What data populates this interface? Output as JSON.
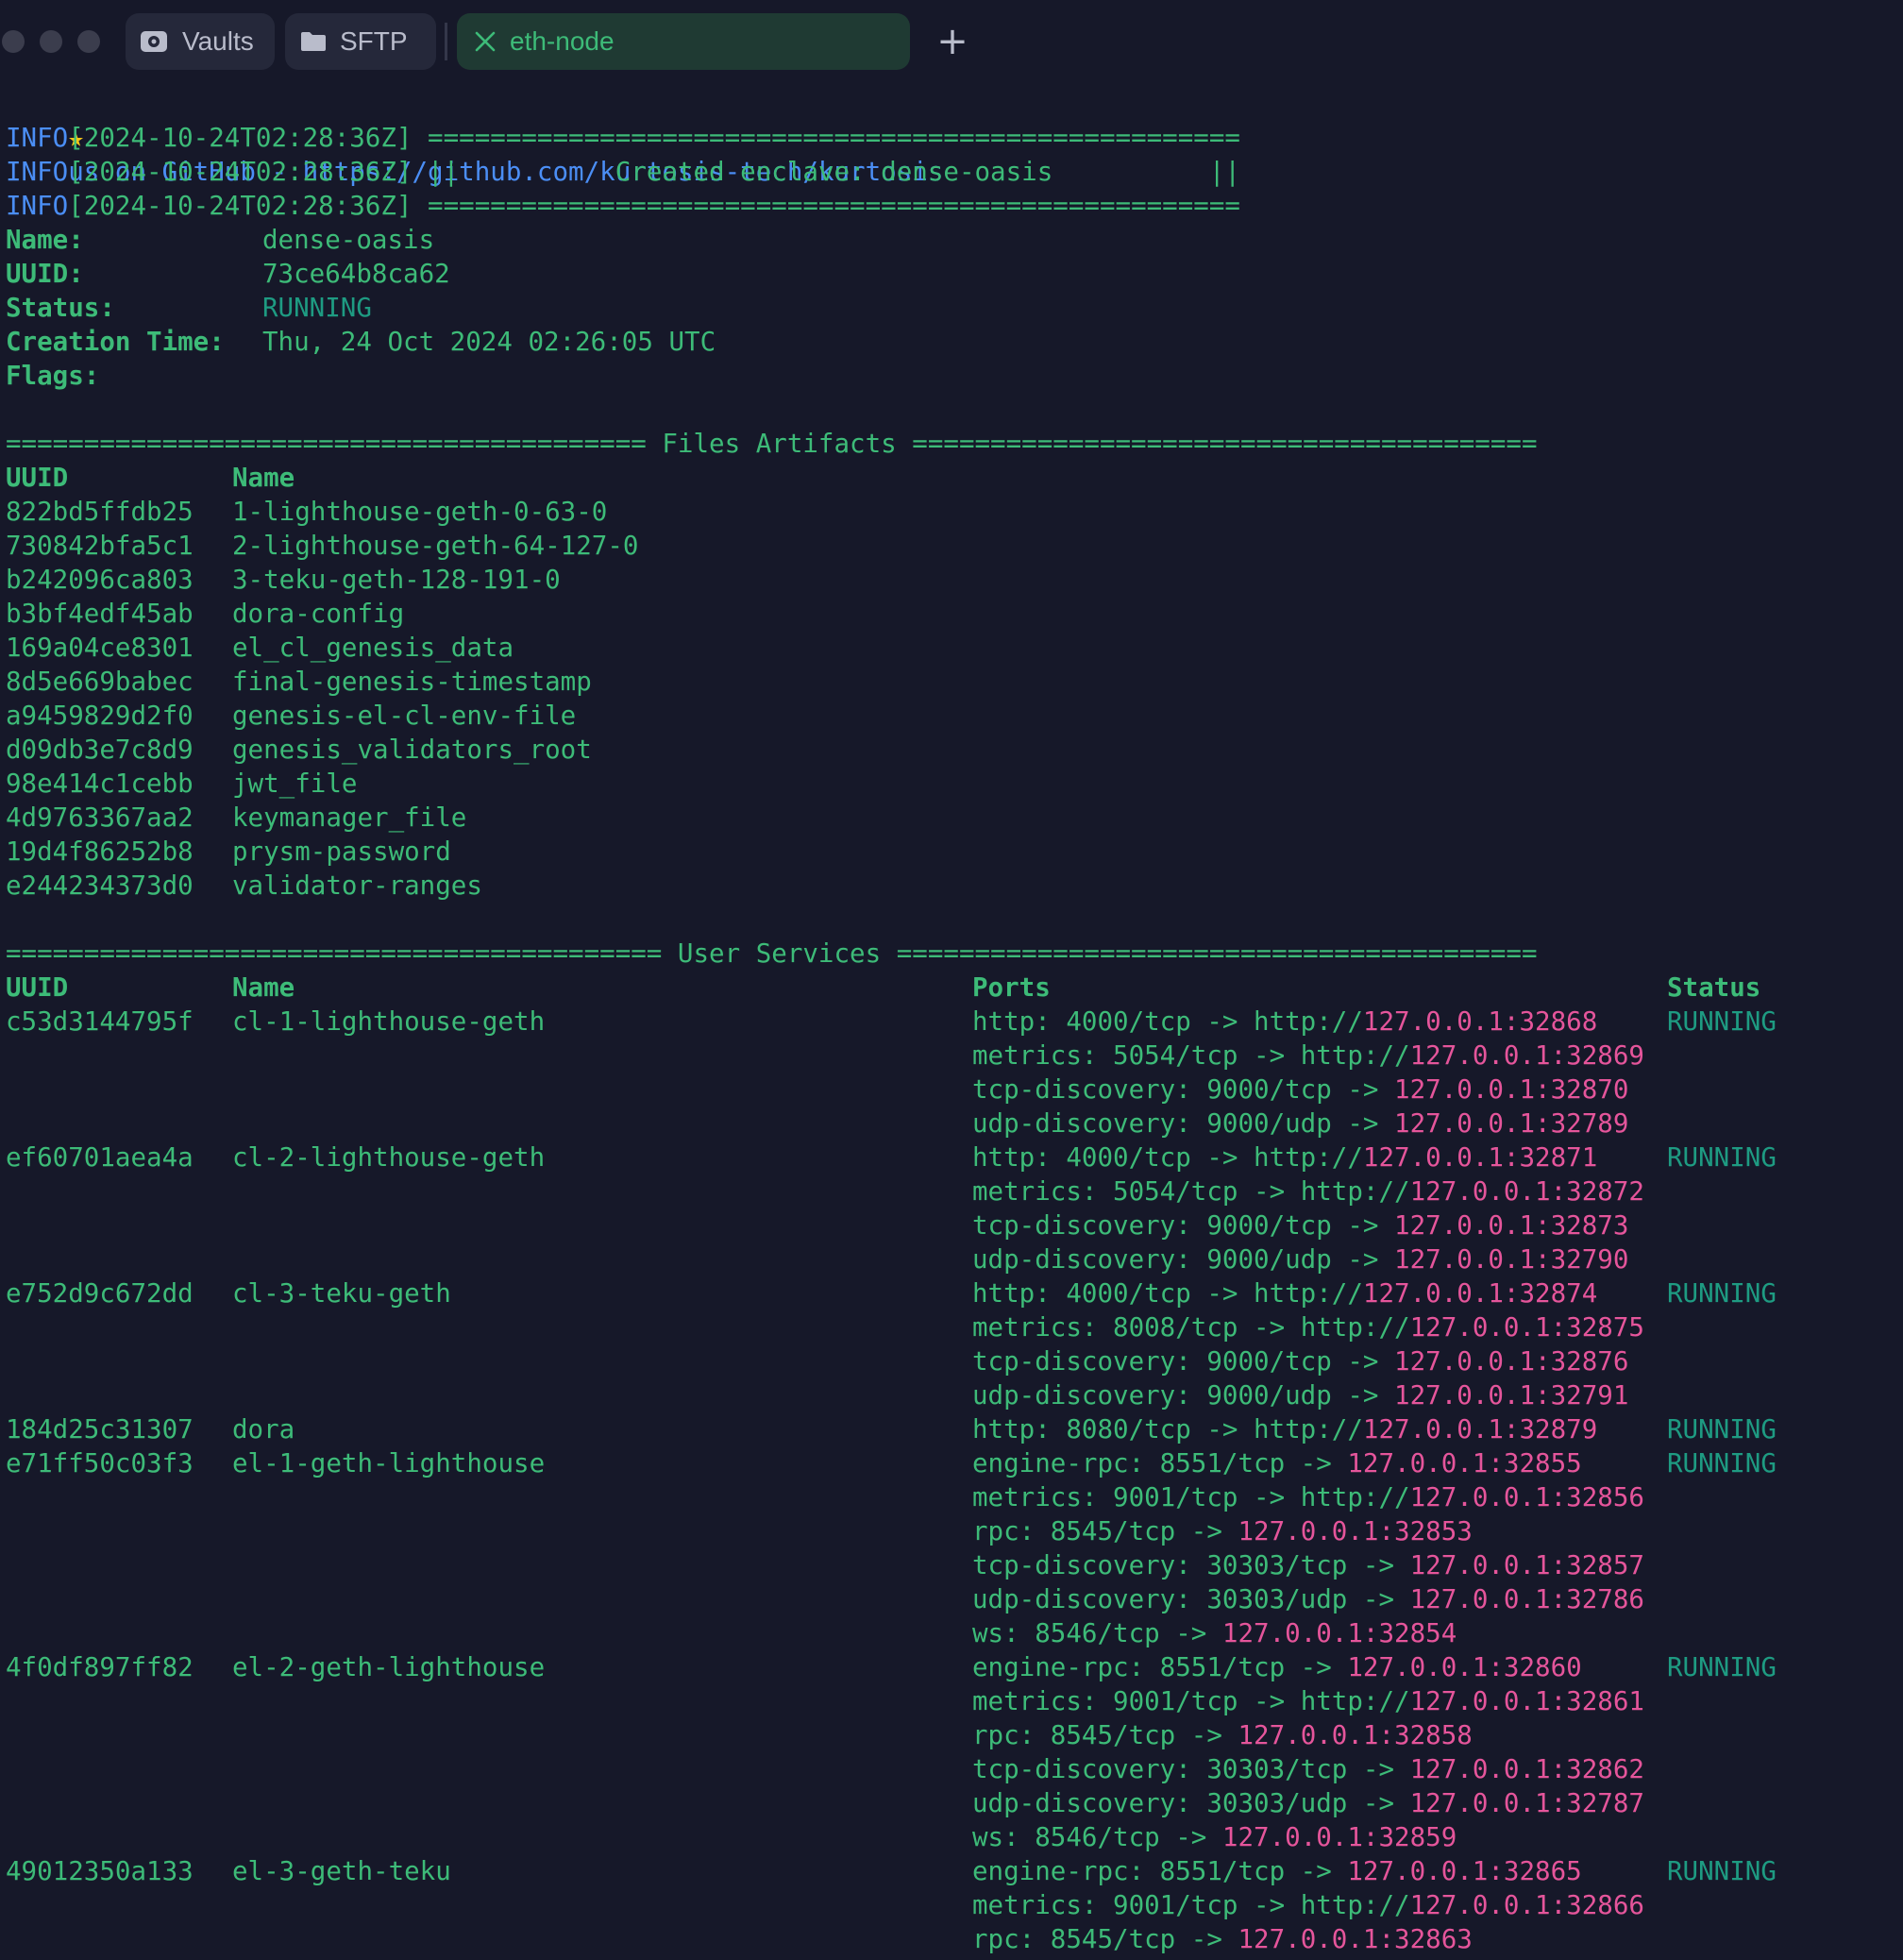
{
  "window": {
    "tabs": [
      {
        "label": "Vaults",
        "icon": "vault-icon"
      },
      {
        "label": "SFTP",
        "icon": "folder-icon"
      },
      {
        "label": "eth-node",
        "icon": "close-icon",
        "active": true
      }
    ],
    "new_tab": "+"
  },
  "terminal": {
    "github_line": "us on GitHub - https://github.com/kurtosis-tech/kurtosis",
    "info_prefix": "INFO",
    "info_lines": [
      "[2024-10-24T02:28:36Z] ====================================================",
      "[2024-10-24T02:28:36Z] ||          Created enclave: dense-oasis          ||",
      "[2024-10-24T02:28:36Z] ===================================================="
    ],
    "enclave": {
      "name_label": "Name:",
      "name": "dense-oasis",
      "uuid_label": "UUID:",
      "uuid": "73ce64b8ca62",
      "status_label": "Status:",
      "status": "RUNNING",
      "creation_label": "Creation Time:",
      "creation_time": "Thu, 24 Oct 2024 02:26:05 UTC",
      "flags_label": "Flags:"
    },
    "files_header": "========================================= Files Artifacts ========================================",
    "files_columns": {
      "uuid": "UUID",
      "name": "Name"
    },
    "files": [
      {
        "uuid": "822bd5ffdb25",
        "name": "1-lighthouse-geth-0-63-0"
      },
      {
        "uuid": "730842bfa5c1",
        "name": "2-lighthouse-geth-64-127-0"
      },
      {
        "uuid": "b242096ca803",
        "name": "3-teku-geth-128-191-0"
      },
      {
        "uuid": "b3bf4edf45ab",
        "name": "dora-config"
      },
      {
        "uuid": "169a04ce8301",
        "name": "el_cl_genesis_data"
      },
      {
        "uuid": "8d5e669babec",
        "name": "final-genesis-timestamp"
      },
      {
        "uuid": "a9459829d2f0",
        "name": "genesis-el-cl-env-file"
      },
      {
        "uuid": "d09db3e7c8d9",
        "name": "genesis_validators_root"
      },
      {
        "uuid": "98e414c1cebb",
        "name": "jwt_file"
      },
      {
        "uuid": "4d9763367aa2",
        "name": "keymanager_file"
      },
      {
        "uuid": "19d4f86252b8",
        "name": "prysm-password"
      },
      {
        "uuid": "e244234373d0",
        "name": "validator-ranges"
      }
    ],
    "services_header": "========================================== User Services =========================================",
    "services_columns": {
      "uuid": "UUID",
      "name": "Name",
      "ports": "Ports",
      "status": "Status"
    },
    "services": [
      {
        "uuid": "c53d3144795f",
        "name": "cl-1-lighthouse-geth",
        "status": "RUNNING",
        "ports": [
          {
            "label": "http: 4000/tcp -> ",
            "target": "http://127.0.0.1:32868"
          },
          {
            "label": "metrics: 5054/tcp -> ",
            "target": "http://127.0.0.1:32869"
          },
          {
            "label": "tcp-discovery: 9000/tcp -> ",
            "target": "127.0.0.1:32870"
          },
          {
            "label": "udp-discovery: 9000/udp -> ",
            "target": "127.0.0.1:32789"
          }
        ]
      },
      {
        "uuid": "ef60701aea4a",
        "name": "cl-2-lighthouse-geth",
        "status": "RUNNING",
        "ports": [
          {
            "label": "http: 4000/tcp -> ",
            "target": "http://127.0.0.1:32871"
          },
          {
            "label": "metrics: 5054/tcp -> ",
            "target": "http://127.0.0.1:32872"
          },
          {
            "label": "tcp-discovery: 9000/tcp -> ",
            "target": "127.0.0.1:32873"
          },
          {
            "label": "udp-discovery: 9000/udp -> ",
            "target": "127.0.0.1:32790"
          }
        ]
      },
      {
        "uuid": "e752d9c672dd",
        "name": "cl-3-teku-geth",
        "status": "RUNNING",
        "ports": [
          {
            "label": "http: 4000/tcp -> ",
            "target": "http://127.0.0.1:32874"
          },
          {
            "label": "metrics: 8008/tcp -> ",
            "target": "http://127.0.0.1:32875"
          },
          {
            "label": "tcp-discovery: 9000/tcp -> ",
            "target": "127.0.0.1:32876"
          },
          {
            "label": "udp-discovery: 9000/udp -> ",
            "target": "127.0.0.1:32791"
          }
        ]
      },
      {
        "uuid": "184d25c31307",
        "name": "dora",
        "status": "RUNNING",
        "ports": [
          {
            "label": "http: 8080/tcp -> ",
            "target": "http://127.0.0.1:32879"
          }
        ]
      },
      {
        "uuid": "e71ff50c03f3",
        "name": "el-1-geth-lighthouse",
        "status": "RUNNING",
        "ports": [
          {
            "label": "engine-rpc: 8551/tcp -> ",
            "target": "127.0.0.1:32855"
          },
          {
            "label": "metrics: 9001/tcp -> ",
            "target": "http://127.0.0.1:32856"
          },
          {
            "label": "rpc: 8545/tcp -> ",
            "target": "127.0.0.1:32853"
          },
          {
            "label": "tcp-discovery: 30303/tcp -> ",
            "target": "127.0.0.1:32857"
          },
          {
            "label": "udp-discovery: 30303/udp -> ",
            "target": "127.0.0.1:32786"
          },
          {
            "label": "ws: 8546/tcp -> ",
            "target": "127.0.0.1:32854"
          }
        ]
      },
      {
        "uuid": "4f0df897ff82",
        "name": "el-2-geth-lighthouse",
        "status": "RUNNING",
        "ports": [
          {
            "label": "engine-rpc: 8551/tcp -> ",
            "target": "127.0.0.1:32860"
          },
          {
            "label": "metrics: 9001/tcp -> ",
            "target": "http://127.0.0.1:32861"
          },
          {
            "label": "rpc: 8545/tcp -> ",
            "target": "127.0.0.1:32858"
          },
          {
            "label": "tcp-discovery: 30303/tcp -> ",
            "target": "127.0.0.1:32862"
          },
          {
            "label": "udp-discovery: 30303/udp -> ",
            "target": "127.0.0.1:32787"
          },
          {
            "label": "ws: 8546/tcp -> ",
            "target": "127.0.0.1:32859"
          }
        ]
      },
      {
        "uuid": "49012350a133",
        "name": "el-3-geth-teku",
        "status": "RUNNING",
        "ports": [
          {
            "label": "engine-rpc: 8551/tcp -> ",
            "target": "127.0.0.1:32865"
          },
          {
            "label": "metrics: 9001/tcp -> ",
            "target": "http://127.0.0.1:32866"
          },
          {
            "label": "rpc: 8545/tcp -> ",
            "target": "127.0.0.1:32863"
          }
        ]
      }
    ]
  },
  "colors": {
    "background": "#161829",
    "green": "#3dbb78",
    "blue": "#4b8ef5",
    "pink": "#e5559b",
    "teal": "#1e9b82"
  }
}
